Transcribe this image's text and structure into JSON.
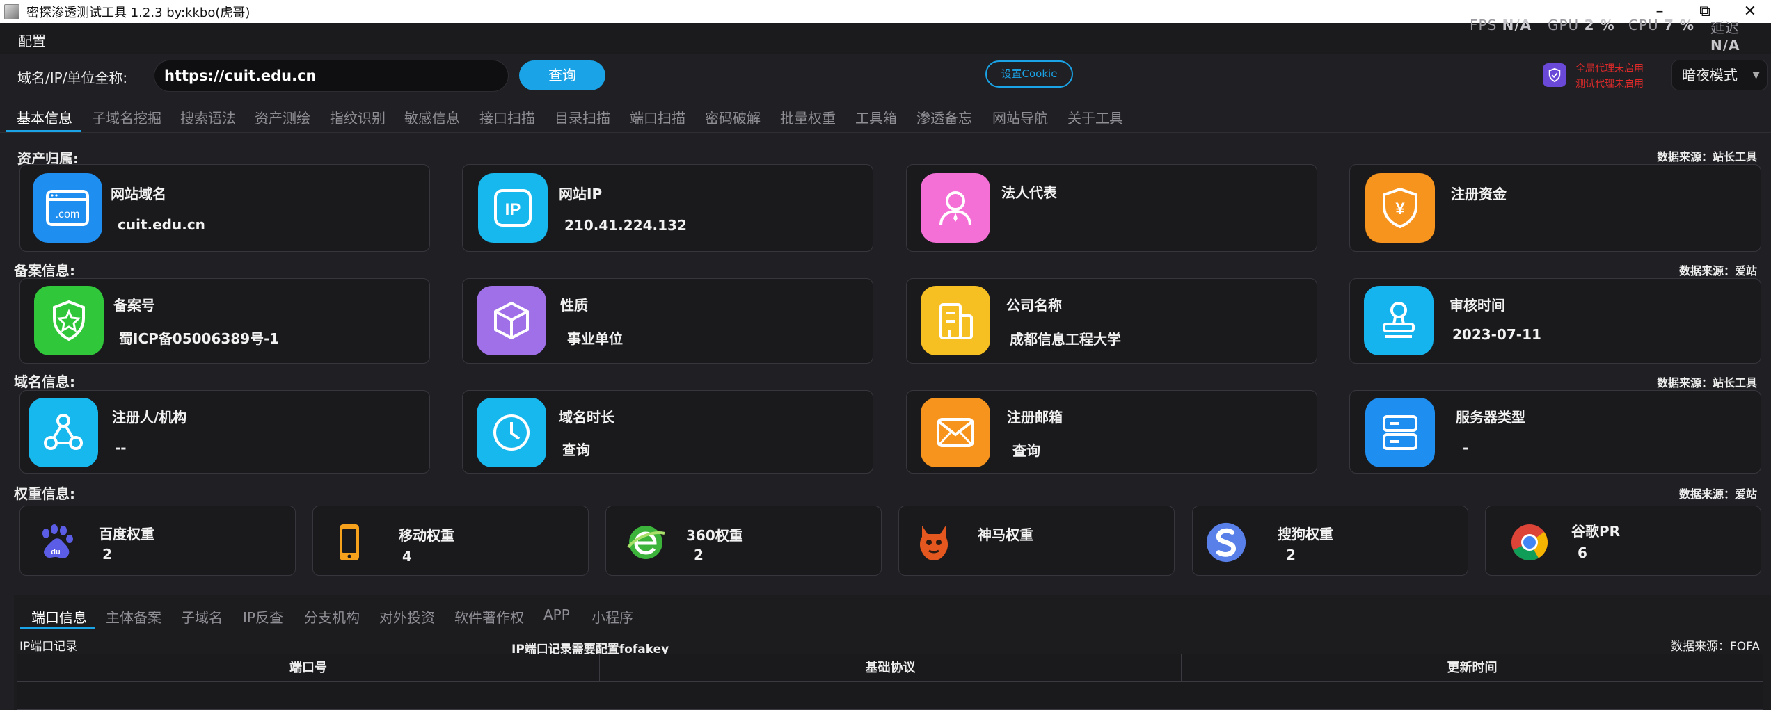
{
  "window": {
    "title": "密探渗透测试工具 1.2.3 by:kkbo(虎哥)",
    "minimize": "–",
    "maximize": "⧉",
    "close": "✕"
  },
  "stats": {
    "fps_label": "FPS",
    "fps": "N/A",
    "gpu_label": "GPU",
    "gpu": "2 %",
    "cpu_label": "CPU",
    "cpu": "7 %",
    "delay_label": "延迟",
    "delay": "N/A"
  },
  "menu": {
    "config": "配置"
  },
  "query": {
    "label": "域名/IP/单位全称:",
    "value": "https://cuit.edu.cn",
    "button": "查询",
    "cookie_button": "设置Cookie",
    "proxy_global": "全局代理未启用",
    "proxy_test": "测试代理未启用",
    "mode": "暗夜模式"
  },
  "main_tabs": [
    "基本信息",
    "子域名挖掘",
    "搜索语法",
    "资产测绘",
    "指纹识别",
    "敏感信息",
    "接口扫描",
    "目录扫描",
    "端口扫描",
    "密码破解",
    "批量权重",
    "工具箱",
    "渗透备忘",
    "网站导航",
    "关于工具"
  ],
  "sections": {
    "asset": {
      "title": "资产归属:",
      "source": "数据来源：站长工具"
    },
    "icp": {
      "title": "备案信息:",
      "source": "数据来源：爱站"
    },
    "domain": {
      "title": "域名信息:",
      "source": "数据来源：站长工具"
    },
    "weight": {
      "title": "权重信息:",
      "source": "数据来源：爱站"
    }
  },
  "asset_cards": [
    {
      "label": "网站域名",
      "value": "cuit.edu.cn",
      "icon": "dotcom-icon",
      "color": "#1e8ff0"
    },
    {
      "label": "网站IP",
      "value": "210.41.224.132",
      "icon": "ip-icon",
      "color": "#16b8ee"
    },
    {
      "label": "法人代表",
      "value": "",
      "icon": "person-icon",
      "color": "#f46fd6"
    },
    {
      "label": "注册资金",
      "value": "",
      "icon": "money-shield-icon",
      "color": "#f7941d"
    }
  ],
  "icp_cards": [
    {
      "label": "备案号",
      "value": "蜀ICP备05006389号-1",
      "icon": "shield-star-icon",
      "color": "#30c83a"
    },
    {
      "label": "性质",
      "value": "事业单位",
      "icon": "cube-icon",
      "color": "#9f70e8"
    },
    {
      "label": "公司名称",
      "value": "成都信息工程大学",
      "icon": "building-icon",
      "color": "#f6c022"
    },
    {
      "label": "审核时间",
      "value": "2023-07-11",
      "icon": "stamp-icon",
      "color": "#16b4ee"
    }
  ],
  "domain_cards": [
    {
      "label": "注册人/机构",
      "value": "--",
      "icon": "org-icon",
      "color": "#16b8ee"
    },
    {
      "label": "域名时长",
      "value": "查询",
      "icon": "clock-icon",
      "color": "#16b8ee"
    },
    {
      "label": "注册邮箱",
      "value": "查询",
      "icon": "mail-icon",
      "color": "#f7941d"
    },
    {
      "label": "服务器类型",
      "value": "-",
      "icon": "server-icon",
      "color": "#1e8ff0"
    }
  ],
  "weight_cards": [
    {
      "label": "百度权重",
      "value": "2",
      "icon": "baidu-icon"
    },
    {
      "label": "移动权重",
      "value": "4",
      "icon": "mobile-icon"
    },
    {
      "label": "360权重",
      "value": "2",
      "icon": "360-icon"
    },
    {
      "label": "神马权重",
      "value": "",
      "icon": "shenma-icon"
    },
    {
      "label": "搜狗权重",
      "value": "2",
      "icon": "sogou-icon"
    },
    {
      "label": "谷歌PR",
      "value": "6",
      "icon": "chrome-icon"
    }
  ],
  "sub_tabs": [
    "端口信息",
    "主体备案",
    "子域名",
    "IP反查",
    "分支机构",
    "对外投资",
    "软件著作权",
    "APP",
    "小程序"
  ],
  "port_panel": {
    "record_label": "IP端口记录",
    "notice": "IP端口记录需要配置fofakey",
    "source": "数据来源：FOFA",
    "columns": [
      "端口号",
      "基础协议",
      "更新时间"
    ]
  }
}
